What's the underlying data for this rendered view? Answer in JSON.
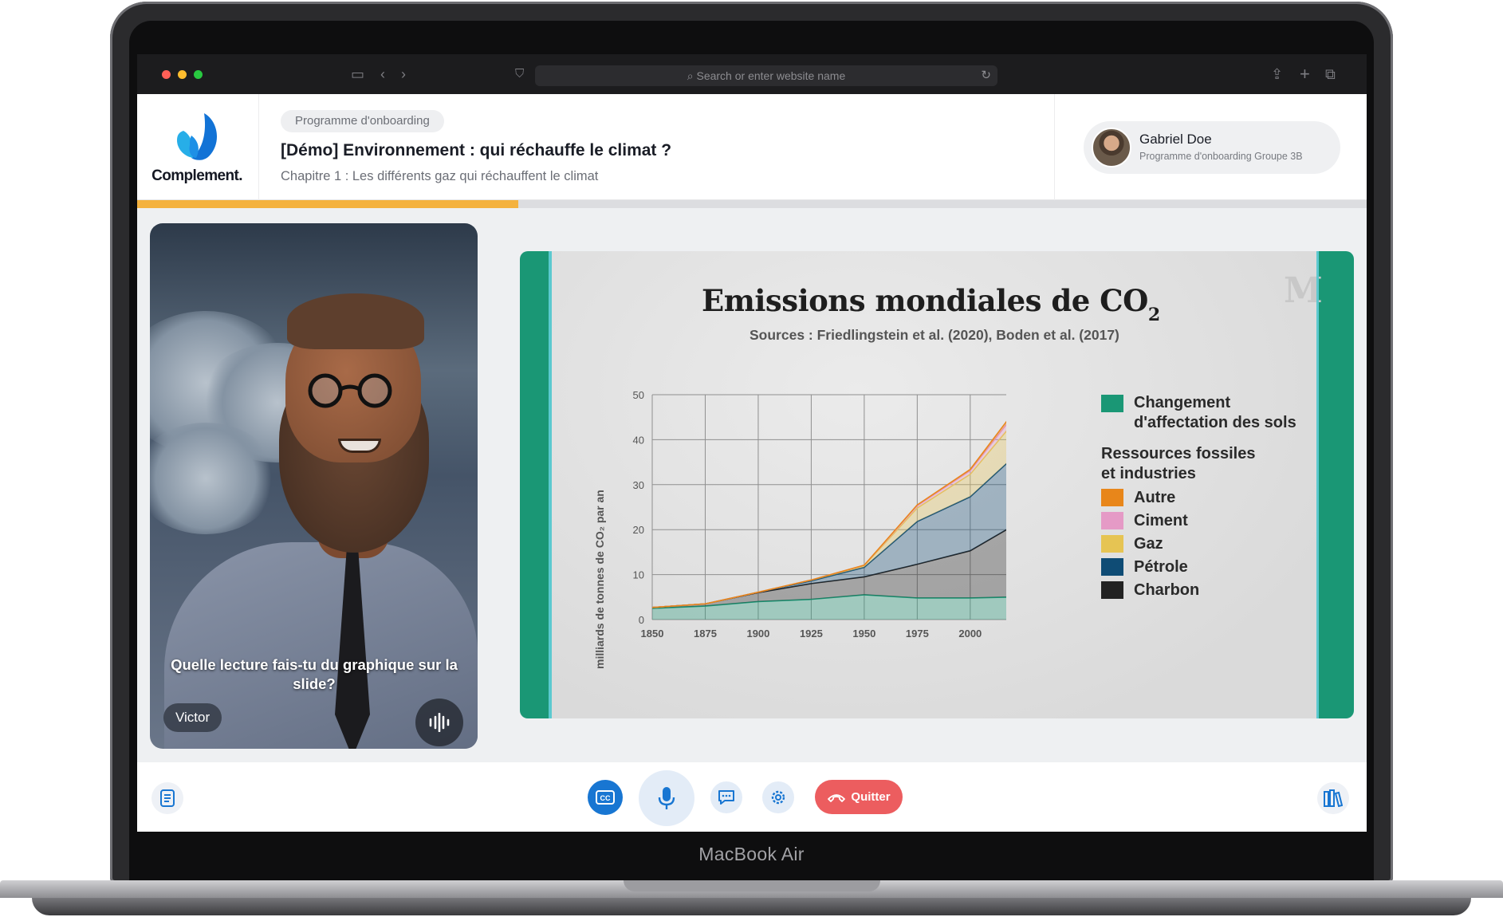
{
  "device": {
    "label": "MacBook Air"
  },
  "browser": {
    "url_placeholder": "Search or enter website name",
    "traffic_lights": {
      "close": "#ff5f57",
      "minimize": "#febc2e",
      "zoom": "#28c840"
    }
  },
  "app": {
    "brand": "Complement.",
    "program_chip": "Programme d'onboarding",
    "title": "[Démo] Environnement : qui réchauffe le climat ?",
    "chapter": "Chapitre 1 : Les différents gaz qui réchauffent le climat",
    "progress_fraction": 0.31,
    "user": {
      "name": "Gabriel Doe",
      "group": "Programme d'onboarding Groupe 3B"
    }
  },
  "video": {
    "caption": "Quelle lecture fais-tu du graphique sur la slide?",
    "speaker": "Victor"
  },
  "slide": {
    "title": "Emissions mondiales de CO",
    "title_sub": "2",
    "source": "Sources : Friedlingstein et al. (2020), Boden et al. (2017)",
    "ylabel": "milliards de tonnes de CO₂ par an"
  },
  "chart_data": {
    "type": "area",
    "title": "Emissions mondiales de CO2",
    "ylabel": "milliards de tonnes de CO₂ par an",
    "xlim": [
      1850,
      2020
    ],
    "ylim": [
      0,
      50
    ],
    "x_ticks": [
      1850,
      1875,
      1900,
      1925,
      1950,
      1975,
      2000
    ],
    "y_ticks": [
      0,
      10,
      20,
      30,
      40,
      50
    ],
    "grid": true,
    "legend_position": "right",
    "x": [
      1850,
      1875,
      1900,
      1925,
      1950,
      1975,
      2000,
      2019
    ],
    "series": [
      {
        "name": "Changement d'affectation des sols",
        "color": "#1a9775",
        "values": [
          2.5,
          3.0,
          4.0,
          4.5,
          5.5,
          4.8,
          4.8,
          5.0
        ]
      },
      {
        "name": "Charbon",
        "color": "#222222",
        "values": [
          0.2,
          0.5,
          2.0,
          3.5,
          4.0,
          7.5,
          10.5,
          15.5
        ]
      },
      {
        "name": "Pétrole",
        "color": "#0f4c75",
        "values": [
          0.0,
          0.0,
          0.1,
          0.6,
          2.1,
          9.5,
          12.0,
          15.0
        ]
      },
      {
        "name": "Gaz",
        "color": "#e6c453",
        "values": [
          0.0,
          0.0,
          0.0,
          0.2,
          0.4,
          3.0,
          5.0,
          7.5
        ]
      },
      {
        "name": "Ciment",
        "color": "#e59ac6",
        "values": [
          0.0,
          0.0,
          0.0,
          0.0,
          0.1,
          0.5,
          0.8,
          1.5
        ]
      },
      {
        "name": "Autre",
        "color": "#e8861a",
        "values": [
          0.0,
          0.0,
          0.0,
          0.0,
          0.0,
          0.2,
          0.3,
          0.7
        ]
      }
    ],
    "legend": {
      "land_use": "Changement d'affectation des sols",
      "group_heading": "Ressources fossiles et industries",
      "items": [
        "Autre",
        "Ciment",
        "Gaz",
        "Pétrole",
        "Charbon"
      ]
    }
  },
  "controls": {
    "quit_label": "Quitter",
    "accent": "#1876d2",
    "quit_color": "#ec5d5f",
    "buttons": [
      "transcript-icon",
      "captions-icon",
      "microphone-icon",
      "chat-icon",
      "settings-icon",
      "phone-hangup-icon",
      "library-icon"
    ]
  }
}
